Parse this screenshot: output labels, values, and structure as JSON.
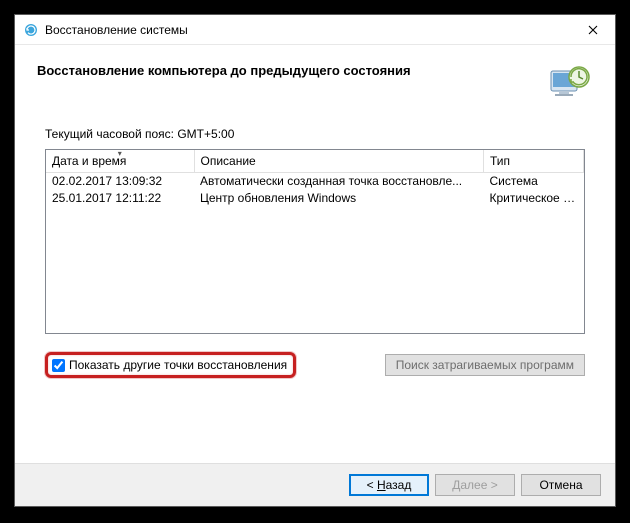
{
  "window": {
    "title": "Восстановление системы"
  },
  "header": {
    "heading": "Восстановление компьютера до предыдущего состояния"
  },
  "timezone_label": "Текущий часовой пояс: GMT+5:00",
  "columns": {
    "date": "Дата и время",
    "desc": "Описание",
    "type": "Тип"
  },
  "rows": [
    {
      "date": "02.02.2017 13:09:32",
      "desc": "Автоматически созданная точка восстановле...",
      "type": "Система"
    },
    {
      "date": "25.01.2017 12:11:22",
      "desc": "Центр обновления Windows",
      "type": "Критическое о..."
    }
  ],
  "checkbox_label": "Показать другие точки восстановления",
  "scan_button": "Поиск затрагиваемых программ",
  "buttons": {
    "back_prefix": "< ",
    "back_mnemonic": "Н",
    "back_suffix": "азад",
    "next_prefix": "",
    "next_mnemonic": "Д",
    "next_suffix": "алее >",
    "cancel": "Отмена"
  }
}
